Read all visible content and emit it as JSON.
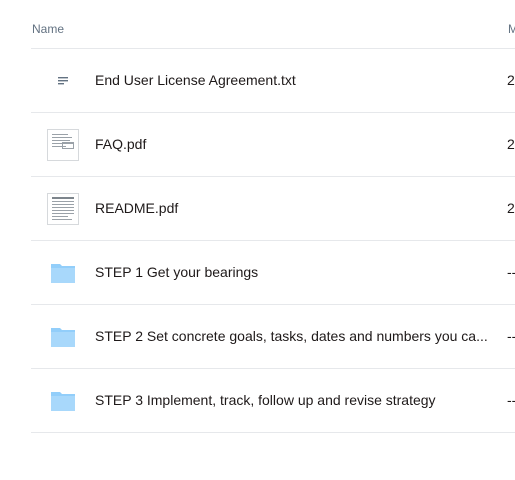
{
  "header": {
    "name_label": "Name",
    "modified_label": "M"
  },
  "files": [
    {
      "name": "End User License Agreement.txt",
      "modified": "2",
      "icon": "text-file-icon",
      "kind": "text"
    },
    {
      "name": "FAQ.pdf",
      "modified": "2",
      "icon": "pdf-thumbnail-icon",
      "kind": "pdf"
    },
    {
      "name": "README.pdf",
      "modified": "2",
      "icon": "pdf-thumbnail-icon",
      "kind": "pdf"
    },
    {
      "name": "STEP 1 Get your bearings",
      "modified": "--",
      "icon": "folder-icon",
      "kind": "folder"
    },
    {
      "name": "STEP 2 Set concrete goals, tasks, dates and numbers you ca...",
      "modified": "--",
      "icon": "folder-icon",
      "kind": "folder"
    },
    {
      "name": "STEP 3 Implement, track, follow up and revise strategy",
      "modified": "--",
      "icon": "folder-icon",
      "kind": "folder"
    }
  ],
  "colors": {
    "folder": "#92cefa",
    "divider": "#e6e8eb",
    "header_text": "#637282",
    "text_icon": "#637282"
  }
}
